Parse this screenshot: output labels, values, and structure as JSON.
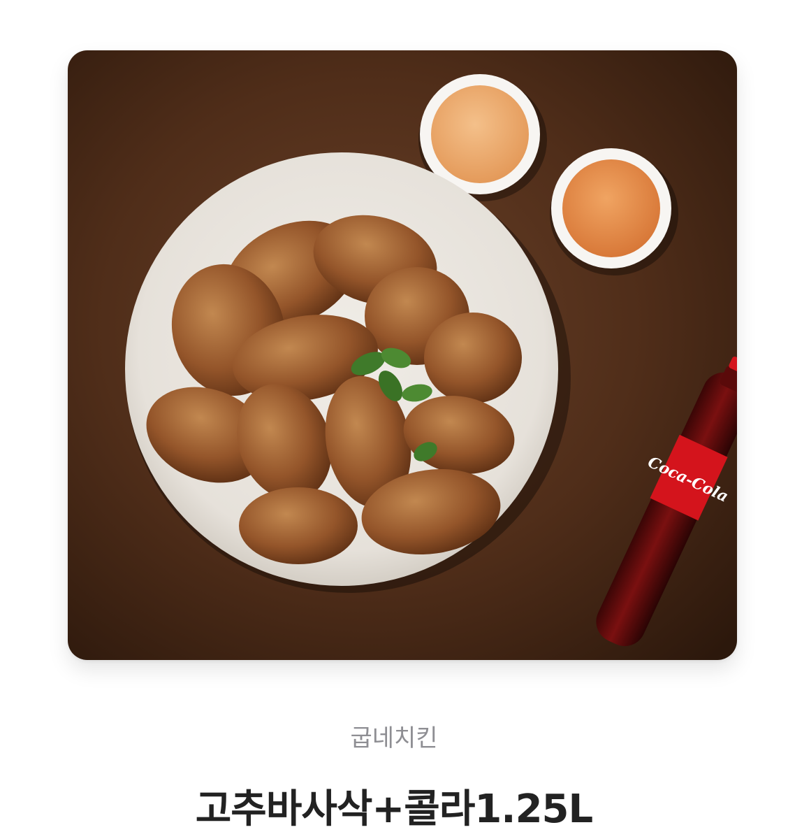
{
  "product": {
    "image_alt": "고추바사삭 치킨과 소스 2종, 코카콜라 1.25L",
    "brand": "굽네치킨",
    "title": "고추바사삭+콜라1.25L",
    "bottle_label": "Coca-Cola"
  },
  "colors": {
    "background": "#ffffff",
    "table_wood": "#4a2a17",
    "plate": "#e9e5df",
    "chicken": "#9a5a2a",
    "sauce_1": "#eaa86a",
    "sauce_2": "#e58d4c",
    "cola_red": "#d4141c",
    "brand_text": "#8e8e93",
    "title_text": "#222222"
  }
}
